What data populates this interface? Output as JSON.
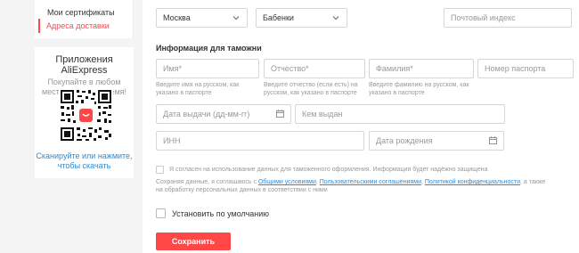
{
  "sidebar": {
    "items": [
      {
        "label": "Мои сертификаты"
      },
      {
        "label": "Адреса доставки"
      }
    ]
  },
  "app_promo": {
    "title": "Приложения AliExpress",
    "subtitle": "Покупайте в любом месте, в любое время!",
    "link": "Сканируйте или нажмите, чтобы скачать"
  },
  "address": {
    "region_value": "Москва",
    "city_value": "Бабенки",
    "zip_placeholder": "Почтовый индекс"
  },
  "customs": {
    "title": "Информация для таможни",
    "first_name_placeholder": "Имя*",
    "patronymic_placeholder": "Отчество*",
    "last_name_placeholder": "Фамилия*",
    "passport_placeholder": "Номер паспорта",
    "first_name_hint": "Введите имя на русском, как указано в паспорте",
    "patronymic_hint": "Введите отчество (если есть) на русском, как указано в паспорте",
    "last_name_hint": "Введите фамилию на русском, как указано в паспорте",
    "issue_date_placeholder": "Дата выдачи (дд-мм-гг)",
    "issued_by_placeholder": "Кем выдан",
    "inn_placeholder": "ИНН",
    "birth_date_placeholder": "Дата рождения"
  },
  "consent": {
    "text": "Я согласен на использование данных для таможенного оформления. Информация будет надёжно защищена",
    "legal_prefix": "Сохраняя данные, я соглашаюсь с ",
    "legal_link1": "Общими условиями",
    "legal_sep1": ", ",
    "legal_link2": "Пользовательскими соглашениями",
    "legal_sep2": ", ",
    "legal_link3": "Политикой конфиденциальности",
    "legal_suffix": ", а также на обработку персональных данных в соответствии с ними"
  },
  "default_label": "Установить по умолчанию",
  "save_label": "Сохранить",
  "colors": {
    "accent": "#ff4747",
    "link": "#2e8bd6"
  }
}
